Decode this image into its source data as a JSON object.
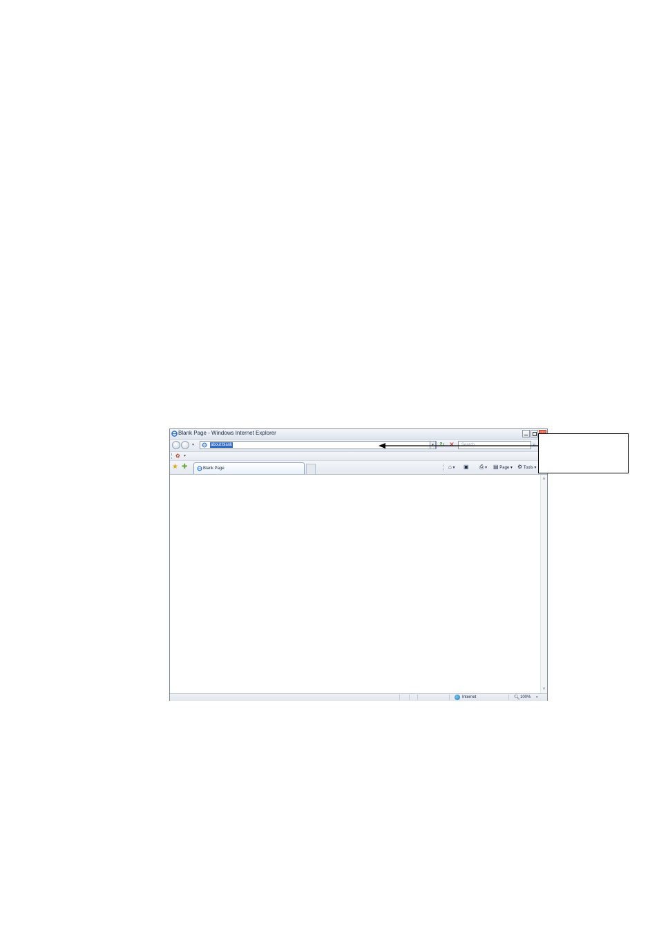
{
  "window": {
    "title": "Blank Page - Windows Internet Explorer"
  },
  "toolbar": {
    "address_value": "about:blank",
    "search_placeholder": "Search"
  },
  "tabs": [
    {
      "label": "Blank Page"
    }
  ],
  "command_bar": {
    "page_label": "Page",
    "tools_label": "Tools"
  },
  "statusbar": {
    "zone": "Internet",
    "zoom": "100%"
  },
  "icons": {
    "browser": "ie-icon",
    "favorites": "star-icon",
    "add_favorites": "add-favorites-icon",
    "home": "home-icon",
    "feeds": "feeds-icon",
    "print": "print-icon",
    "page": "page-icon",
    "tools": "gear-icon",
    "zone": "globe-icon",
    "zoom": "magnifier-icon"
  },
  "colors": {
    "address_highlight": "#316ac5",
    "stop": "#cc2b1d",
    "refresh": "#3d8f2f",
    "star": "#e0a814"
  }
}
